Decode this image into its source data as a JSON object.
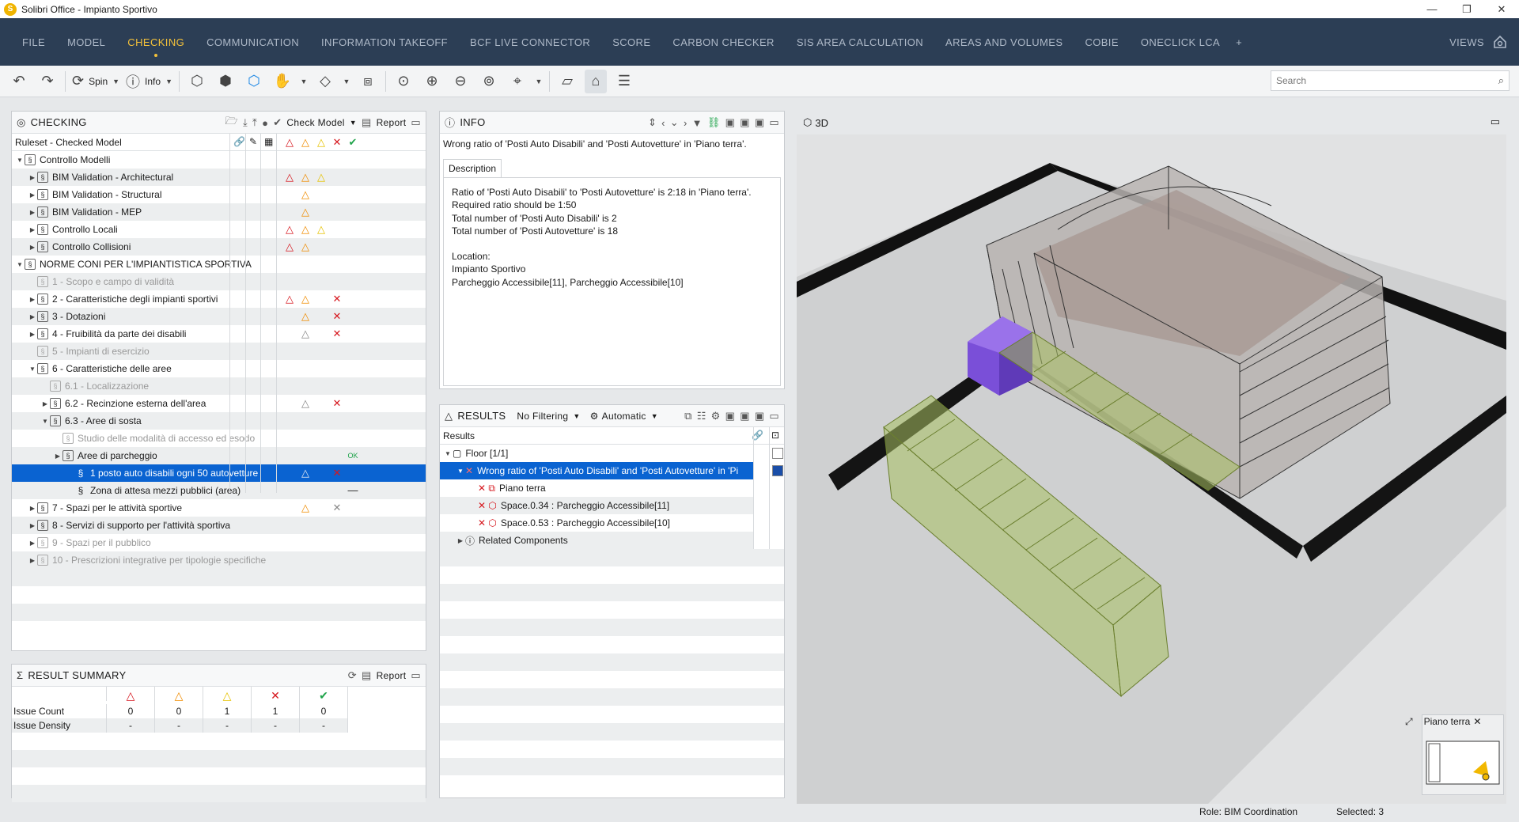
{
  "window": {
    "title": "Solibri Office - Impianto Sportivo",
    "logo_letter": "S"
  },
  "menu": {
    "items": [
      "FILE",
      "MODEL",
      "CHECKING",
      "COMMUNICATION",
      "INFORMATION TAKEOFF",
      "BCF LIVE CONNECTOR",
      "SCORE",
      "CARBON CHECKER",
      "SIS AREA CALCULATION",
      "AREAS AND VOLUMES",
      "COBIE",
      "ONECLICK LCA"
    ],
    "active": "CHECKING",
    "add": "+",
    "views": "VIEWS"
  },
  "toolbar": {
    "spin": "Spin",
    "info": "Info",
    "search_placeholder": "Search"
  },
  "checking": {
    "title": "CHECKING",
    "check_model": "Check Model",
    "report": "Report",
    "column_header": "Ruleset - Checked Model",
    "rows": [
      {
        "label": "Controllo Modelli",
        "indent": 0,
        "tri": "▼",
        "dim": false,
        "sel": false,
        "marks": [
          "",
          "",
          "",
          "",
          ""
        ]
      },
      {
        "label": "BIM Validation - Architectural",
        "indent": 1,
        "tri": "▶",
        "dim": false,
        "sel": false,
        "marks": [
          "red",
          "orange",
          "yellow",
          "",
          ""
        ]
      },
      {
        "label": "BIM Validation - Structural",
        "indent": 1,
        "tri": "▶",
        "dim": false,
        "sel": false,
        "marks": [
          "",
          "orange",
          "",
          "",
          ""
        ]
      },
      {
        "label": "BIM Validation - MEP",
        "indent": 1,
        "tri": "▶",
        "dim": false,
        "sel": false,
        "marks": [
          "",
          "orange",
          "",
          "",
          ""
        ]
      },
      {
        "label": "Controllo Locali",
        "indent": 1,
        "tri": "▶",
        "dim": false,
        "sel": false,
        "marks": [
          "red",
          "orange",
          "yellow",
          "",
          ""
        ]
      },
      {
        "label": "Controllo Collisioni",
        "indent": 1,
        "tri": "▶",
        "dim": false,
        "sel": false,
        "marks": [
          "red",
          "orange",
          "",
          "",
          ""
        ]
      },
      {
        "label": "NORME CONI PER L'IMPIANTISTICA SPORTIVA",
        "indent": 0,
        "tri": "▼",
        "dim": false,
        "sel": false,
        "marks": [
          "",
          "",
          "",
          "",
          ""
        ]
      },
      {
        "label": "1 - Scopo e campo di validità",
        "indent": 1,
        "tri": "",
        "dim": true,
        "sel": false,
        "marks": [
          "",
          "",
          "",
          "",
          ""
        ]
      },
      {
        "label": "2 - Caratteristiche degli impianti sportivi",
        "indent": 1,
        "tri": "▶",
        "dim": false,
        "sel": false,
        "marks": [
          "red",
          "orange",
          "",
          "x",
          ""
        ]
      },
      {
        "label": "3 - Dotazioni",
        "indent": 1,
        "tri": "▶",
        "dim": false,
        "sel": false,
        "marks": [
          "",
          "orange",
          "",
          "x",
          ""
        ]
      },
      {
        "label": "4 - Fruibilità da parte dei disabili",
        "indent": 1,
        "tri": "▶",
        "dim": false,
        "sel": false,
        "marks": [
          "",
          "grey",
          "",
          "x",
          ""
        ]
      },
      {
        "label": "5 - Impianti di esercizio",
        "indent": 1,
        "tri": "",
        "dim": true,
        "sel": false,
        "marks": [
          "",
          "",
          "",
          "",
          ""
        ]
      },
      {
        "label": "6 - Caratteristiche delle aree",
        "indent": 1,
        "tri": "▼",
        "dim": false,
        "sel": false,
        "marks": [
          "",
          "",
          "",
          "",
          ""
        ]
      },
      {
        "label": "6.1 - Localizzazione",
        "indent": 2,
        "tri": "",
        "dim": true,
        "sel": false,
        "marks": [
          "",
          "",
          "",
          "",
          ""
        ]
      },
      {
        "label": "6.2 - Recinzione esterna dell'area",
        "indent": 2,
        "tri": "▶",
        "dim": false,
        "sel": false,
        "marks": [
          "",
          "grey",
          "",
          "x",
          ""
        ]
      },
      {
        "label": "6.3 - Aree di sosta",
        "indent": 2,
        "tri": "▼",
        "dim": false,
        "sel": false,
        "marks": [
          "",
          "",
          "",
          "",
          ""
        ]
      },
      {
        "label": "Studio delle modalità di accesso ed esodo",
        "indent": 3,
        "tri": "",
        "dim": true,
        "sel": false,
        "marks": [
          "",
          "",
          "",
          "",
          ""
        ]
      },
      {
        "label": "Aree di parcheggio",
        "indent": 3,
        "tri": "▶",
        "dim": false,
        "sel": false,
        "marks": [
          "",
          "",
          "",
          "",
          "ok"
        ]
      },
      {
        "label": "1 posto auto disabili ogni 50 autovetture",
        "indent": 4,
        "tri": "",
        "dim": false,
        "sel": true,
        "marks": [
          "",
          "grey",
          "",
          "x",
          ""
        ]
      },
      {
        "label": "Zona di attesa mezzi pubblici (area)",
        "indent": 4,
        "tri": "",
        "dim": false,
        "sel": false,
        "marks": [
          "",
          "",
          "",
          "",
          "dash"
        ]
      },
      {
        "label": "7 - Spazi per le attività sportive",
        "indent": 1,
        "tri": "▶",
        "dim": false,
        "sel": false,
        "marks": [
          "",
          "orange",
          "",
          "xgrey",
          ""
        ]
      },
      {
        "label": "8 - Servizi di supporto per l'attività sportiva",
        "indent": 1,
        "tri": "▶",
        "dim": false,
        "sel": false,
        "marks": [
          "",
          "",
          "",
          "",
          ""
        ]
      },
      {
        "label": "9 - Spazi per il pubblico",
        "indent": 1,
        "tri": "▶",
        "dim": true,
        "sel": false,
        "marks": [
          "",
          "",
          "",
          "",
          ""
        ]
      },
      {
        "label": "10 - Prescrizioni integrative per tipologie specifiche",
        "indent": 1,
        "tri": "▶",
        "dim": true,
        "sel": false,
        "marks": [
          "",
          "",
          "",
          "",
          ""
        ]
      }
    ]
  },
  "summary": {
    "title": "RESULT SUMMARY",
    "report": "Report",
    "rows": [
      {
        "label": "Issue Count",
        "values": [
          "0",
          "0",
          "1",
          "1",
          "0"
        ]
      },
      {
        "label": "Issue Density",
        "values": [
          "-",
          "-",
          "-",
          "-",
          "-"
        ]
      }
    ]
  },
  "info": {
    "title": "INFO",
    "headline": "Wrong ratio of 'Posti Auto Disabili' and 'Posti Autovetture' in 'Piano terra'.",
    "tab": "Description",
    "lines": [
      "Ratio of 'Posti Auto Disabili' to 'Posti Autovetture' is 2:18 in 'Piano terra'.",
      "Required ratio should be 1:50",
      "Total number of 'Posti Auto Disabili' is 2",
      "Total number of 'Posti Autovetture' is 18",
      "",
      "Location:",
      "Impianto Sportivo",
      "Parcheggio Accessibile[11], Parcheggio Accessibile[10]"
    ]
  },
  "results": {
    "title": "RESULTS",
    "filter": "No Filtering",
    "mode": "Automatic",
    "column_header": "Results",
    "rows": [
      {
        "label": "Floor [1/1]",
        "indent": 0,
        "tri": "▼",
        "icon": "folder",
        "sel": false
      },
      {
        "label": "Wrong ratio of 'Posti Auto Disabili' and 'Posti Autovetture' in 'Pi",
        "indent": 1,
        "tri": "▼",
        "icon": "x",
        "sel": true
      },
      {
        "label": "Piano terra",
        "indent": 2,
        "tri": "",
        "icon": "xfloor",
        "sel": false
      },
      {
        "label": "Space.0.34 : Parcheggio Accessibile[11]",
        "indent": 2,
        "tri": "",
        "icon": "xspace",
        "sel": false
      },
      {
        "label": "Space.0.53 : Parcheggio Accessibile[10]",
        "indent": 2,
        "tri": "",
        "icon": "xspace",
        "sel": false
      },
      {
        "label": "Related Components",
        "indent": 1,
        "tri": "▶",
        "icon": "info",
        "sel": false
      }
    ]
  },
  "view3d": {
    "title": "3D",
    "floor_label": "Piano terra"
  },
  "status": {
    "role": "Role: BIM Coordination",
    "selected": "Selected: 3"
  },
  "colors": {
    "menubar": "#2c3e55",
    "accent": "#f3c13a",
    "selection": "#0a63d1",
    "error": "#d6171e",
    "warning_orange": "#f08c00",
    "warning_yellow": "#e6c200",
    "ok": "#1fa34a"
  }
}
